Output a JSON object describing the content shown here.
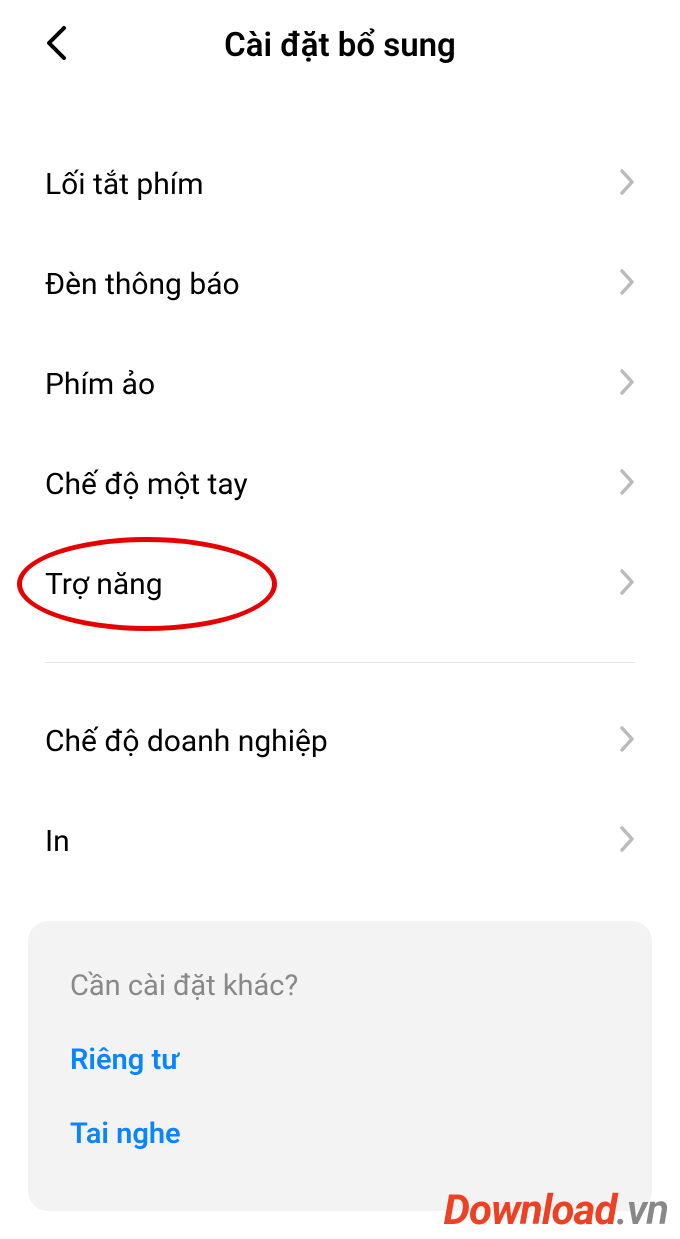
{
  "header": {
    "title": "Cài đặt bổ sung"
  },
  "items": [
    {
      "label": "Lối tắt phím"
    },
    {
      "label": "Đèn thông báo"
    },
    {
      "label": "Phím ảo"
    },
    {
      "label": "Chế độ một tay"
    },
    {
      "label": "Trợ năng"
    },
    {
      "label": "Chế độ doanh nghiệp"
    },
    {
      "label": "In"
    }
  ],
  "card": {
    "title": "Cần cài đặt khác?",
    "links": [
      {
        "label": "Riêng tư"
      },
      {
        "label": "Tai nghe"
      }
    ]
  },
  "watermark": {
    "main": "Download",
    "suffix": ".vn"
  }
}
